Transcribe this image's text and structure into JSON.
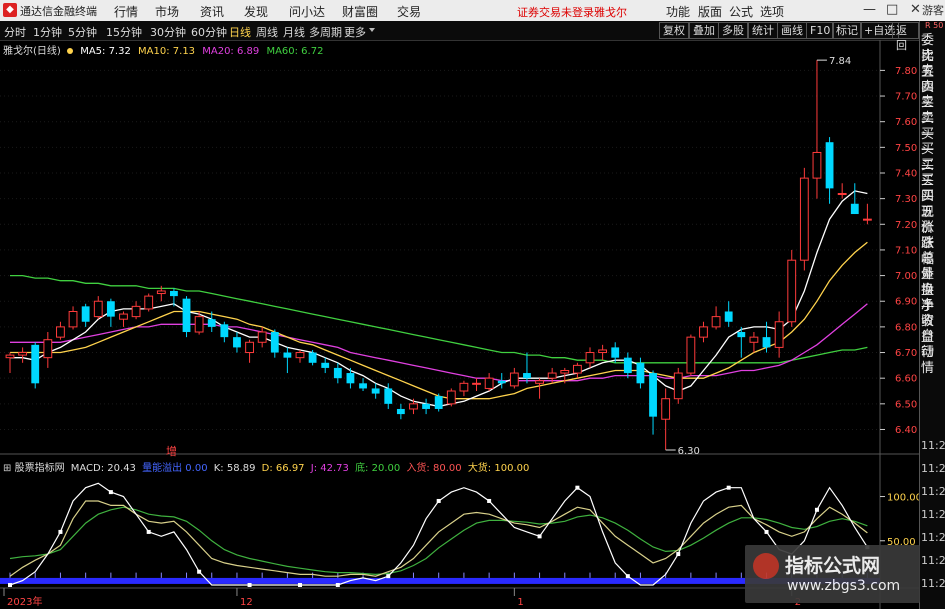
{
  "app": {
    "title": "通达信金融终端",
    "status_warning": "证券交易未登录",
    "stock_short": "雅戈尔"
  },
  "top_menu": [
    "行情",
    "市场",
    "资讯",
    "发现",
    "问小达",
    "财富圈",
    "交易"
  ],
  "right_menu": [
    "功能",
    "版面",
    "公式",
    "选项"
  ],
  "window_buttons": [
    "—",
    "□",
    "✕"
  ],
  "periods": [
    "分时",
    "1分钟",
    "5分钟",
    "15分钟",
    "30分钟",
    "60分钟",
    "日线",
    "周线",
    "月线",
    "多周期",
    "更多"
  ],
  "active_period": "日线",
  "tools": [
    "复权",
    "叠加",
    "多股",
    "统计",
    "画线",
    "F10",
    "标记",
    "+自选",
    "返回"
  ],
  "main_legend": {
    "name": "雅戈尔(日线)",
    "ma5": "MA5: 7.32",
    "ma10": "MA10: 7.13",
    "ma20": "MA20: 6.89",
    "ma60": "MA60: 6.72",
    "colors": {
      "ma5": "#ffffff",
      "ma10": "#ffd34d",
      "ma20": "#e040e0",
      "ma60": "#40d040",
      "up": "#ff3b3b",
      "down": "#00d8ff"
    }
  },
  "sub_legend": {
    "name": "股票指标网",
    "macd": "MACD: 20.43",
    "status": "量能溢出",
    "status_val": "0.00",
    "k": "K: 58.89",
    "d": "D: 66.97",
    "j": "J: 42.73",
    "di": "底: 20.00",
    "ru": "入货: 80.00",
    "da": "大货: 100.00"
  },
  "marker_label": "增",
  "right_panel": {
    "items": [
      "委比",
      "卖五",
      "卖四",
      "卖三",
      "卖二",
      "卖一",
      "买一",
      "买二",
      "买三",
      "买四",
      "买五",
      "现价",
      "涨跌",
      "涨幅",
      "总量",
      "外盘",
      "换手",
      "净资",
      "收益",
      "自动",
      "行情"
    ],
    "time_prefix": "11:25",
    "time_count": 7,
    "top_label": "R 50"
  },
  "login_label": "游客",
  "x_labels": [
    "2023年",
    "12",
    "1",
    "2"
  ],
  "watermark": {
    "title": "指标公式网",
    "url": "www.zbgs3.com"
  },
  "chart_data": {
    "type": "candlestick",
    "yaxis_ticks": [
      7.8,
      7.7,
      7.6,
      7.5,
      7.4,
      7.3,
      7.2,
      7.1,
      7.0,
      6.9,
      6.8,
      6.7,
      6.6,
      6.5,
      6.4
    ],
    "ylim": [
      6.32,
      7.86
    ],
    "annotations": [
      {
        "text": "7.84",
        "type": "high"
      },
      {
        "text": "6.30",
        "type": "low"
      }
    ],
    "candles": [
      [
        6.68,
        6.7,
        6.62,
        6.69
      ],
      [
        6.69,
        6.72,
        6.66,
        6.7
      ],
      [
        6.73,
        6.74,
        6.56,
        6.58
      ],
      [
        6.68,
        6.78,
        6.64,
        6.75
      ],
      [
        6.76,
        6.82,
        6.75,
        6.8
      ],
      [
        6.8,
        6.88,
        6.79,
        6.86
      ],
      [
        6.88,
        6.89,
        6.8,
        6.82
      ],
      [
        6.84,
        6.92,
        6.83,
        6.9
      ],
      [
        6.9,
        6.91,
        6.8,
        6.84
      ],
      [
        6.83,
        6.86,
        6.8,
        6.85
      ],
      [
        6.84,
        6.9,
        6.83,
        6.88
      ],
      [
        6.87,
        6.93,
        6.86,
        6.92
      ],
      [
        6.93,
        6.96,
        6.9,
        6.94
      ],
      [
        6.94,
        6.95,
        6.88,
        6.92
      ],
      [
        6.91,
        6.92,
        6.76,
        6.78
      ],
      [
        6.78,
        6.86,
        6.77,
        6.84
      ],
      [
        6.83,
        6.86,
        6.78,
        6.8
      ],
      [
        6.81,
        6.82,
        6.74,
        6.76
      ],
      [
        6.76,
        6.78,
        6.7,
        6.72
      ],
      [
        6.7,
        6.75,
        6.66,
        6.74
      ],
      [
        6.74,
        6.8,
        6.72,
        6.78
      ],
      [
        6.78,
        6.79,
        6.68,
        6.7
      ],
      [
        6.7,
        6.72,
        6.62,
        6.68
      ],
      [
        6.68,
        6.71,
        6.66,
        6.7
      ],
      [
        6.7,
        6.71,
        6.65,
        6.66
      ],
      [
        6.66,
        6.68,
        6.62,
        6.64
      ],
      [
        6.64,
        6.66,
        6.58,
        6.6
      ],
      [
        6.62,
        6.64,
        6.56,
        6.58
      ],
      [
        6.58,
        6.6,
        6.55,
        6.56
      ],
      [
        6.56,
        6.58,
        6.52,
        6.54
      ],
      [
        6.56,
        6.58,
        6.48,
        6.5
      ],
      [
        6.48,
        6.5,
        6.44,
        6.46
      ],
      [
        6.48,
        6.52,
        6.46,
        6.5
      ],
      [
        6.5,
        6.52,
        6.46,
        6.48
      ],
      [
        6.53,
        6.54,
        6.47,
        6.48
      ],
      [
        6.5,
        6.56,
        6.49,
        6.55
      ],
      [
        6.55,
        6.59,
        6.53,
        6.58
      ],
      [
        6.58,
        6.6,
        6.55,
        6.58
      ],
      [
        6.56,
        6.62,
        6.55,
        6.6
      ],
      [
        6.59,
        6.62,
        6.56,
        6.58
      ],
      [
        6.57,
        6.64,
        6.56,
        6.62
      ],
      [
        6.62,
        6.7,
        6.58,
        6.6
      ],
      [
        6.58,
        6.6,
        6.52,
        6.59
      ],
      [
        6.6,
        6.64,
        6.58,
        6.62
      ],
      [
        6.62,
        6.64,
        6.58,
        6.63
      ],
      [
        6.62,
        6.66,
        6.6,
        6.65
      ],
      [
        6.66,
        6.72,
        6.64,
        6.7
      ],
      [
        6.7,
        6.73,
        6.67,
        6.71
      ],
      [
        6.72,
        6.74,
        6.66,
        6.68
      ],
      [
        6.68,
        6.7,
        6.6,
        6.62
      ],
      [
        6.66,
        6.68,
        6.56,
        6.58
      ],
      [
        6.62,
        6.63,
        6.38,
        6.45
      ],
      [
        6.44,
        6.56,
        6.32,
        6.52
      ],
      [
        6.52,
        6.64,
        6.5,
        6.62
      ],
      [
        6.62,
        6.77,
        6.61,
        6.76
      ],
      [
        6.76,
        6.82,
        6.74,
        6.8
      ],
      [
        6.8,
        6.88,
        6.79,
        6.84
      ],
      [
        6.86,
        6.9,
        6.8,
        6.82
      ],
      [
        6.78,
        6.8,
        6.68,
        6.76
      ],
      [
        6.74,
        6.78,
        6.7,
        6.76
      ],
      [
        6.76,
        6.82,
        6.7,
        6.72
      ],
      [
        6.72,
        6.86,
        6.68,
        6.82
      ],
      [
        6.82,
        7.1,
        6.8,
        7.06
      ],
      [
        7.06,
        7.42,
        7.02,
        7.38
      ],
      [
        7.38,
        7.84,
        7.3,
        7.48
      ],
      [
        7.52,
        7.54,
        7.28,
        7.34
      ],
      [
        7.32,
        7.36,
        7.3,
        7.32
      ],
      [
        7.28,
        7.36,
        7.24,
        7.24
      ],
      [
        7.22,
        7.28,
        7.2,
        7.22
      ]
    ],
    "ma5": [
      6.68,
      6.68,
      6.67,
      6.7,
      6.72,
      6.75,
      6.78,
      6.83,
      6.86,
      6.87,
      6.87,
      6.87,
      6.88,
      6.89,
      6.86,
      6.85,
      6.83,
      6.8,
      6.78,
      6.76,
      6.76,
      6.74,
      6.72,
      6.71,
      6.7,
      6.68,
      6.66,
      6.63,
      6.61,
      6.58,
      6.56,
      6.53,
      6.51,
      6.5,
      6.49,
      6.5,
      6.51,
      6.53,
      6.55,
      6.58,
      6.6,
      6.6,
      6.6,
      6.6,
      6.61,
      6.62,
      6.64,
      6.66,
      6.67,
      6.67,
      6.65,
      6.61,
      6.57,
      6.55,
      6.57,
      6.63,
      6.69,
      6.76,
      6.79,
      6.8,
      6.8,
      6.79,
      6.83,
      6.94,
      7.09,
      7.22,
      7.29,
      7.33,
      7.32
    ],
    "ma10": [
      6.7,
      6.7,
      6.7,
      6.7,
      6.7,
      6.71,
      6.72,
      6.74,
      6.76,
      6.78,
      6.8,
      6.82,
      6.84,
      6.86,
      6.86,
      6.86,
      6.85,
      6.84,
      6.83,
      6.81,
      6.8,
      6.78,
      6.76,
      6.74,
      6.73,
      6.71,
      6.69,
      6.67,
      6.65,
      6.63,
      6.61,
      6.59,
      6.57,
      6.55,
      6.53,
      6.52,
      6.52,
      6.52,
      6.52,
      6.53,
      6.54,
      6.56,
      6.57,
      6.58,
      6.59,
      6.6,
      6.61,
      6.62,
      6.63,
      6.63,
      6.63,
      6.62,
      6.61,
      6.6,
      6.6,
      6.6,
      6.62,
      6.64,
      6.67,
      6.7,
      6.72,
      6.74,
      6.78,
      6.83,
      6.9,
      6.98,
      7.04,
      7.09,
      7.13
    ],
    "ma20": [
      6.74,
      6.74,
      6.74,
      6.74,
      6.74,
      6.75,
      6.76,
      6.77,
      6.78,
      6.79,
      6.8,
      6.8,
      6.81,
      6.81,
      6.81,
      6.81,
      6.81,
      6.8,
      6.8,
      6.79,
      6.78,
      6.77,
      6.76,
      6.75,
      6.74,
      6.73,
      6.72,
      6.7,
      6.69,
      6.68,
      6.67,
      6.66,
      6.65,
      6.64,
      6.63,
      6.62,
      6.61,
      6.6,
      6.6,
      6.59,
      6.59,
      6.59,
      6.59,
      6.59,
      6.59,
      6.59,
      6.6,
      6.6,
      6.61,
      6.61,
      6.61,
      6.61,
      6.6,
      6.6,
      6.61,
      6.61,
      6.61,
      6.62,
      6.63,
      6.63,
      6.64,
      6.65,
      6.67,
      6.7,
      6.73,
      6.77,
      6.81,
      6.85,
      6.89
    ],
    "ma60": [
      7.0,
      7.0,
      6.99,
      6.99,
      6.98,
      6.98,
      6.97,
      6.97,
      6.96,
      6.96,
      6.96,
      6.95,
      6.95,
      6.95,
      6.94,
      6.94,
      6.93,
      6.92,
      6.91,
      6.9,
      6.89,
      6.88,
      6.87,
      6.86,
      6.85,
      6.84,
      6.83,
      6.82,
      6.81,
      6.8,
      6.79,
      6.78,
      6.77,
      6.76,
      6.75,
      6.74,
      6.73,
      6.72,
      6.71,
      6.7,
      6.7,
      6.69,
      6.69,
      6.68,
      6.68,
      6.67,
      6.67,
      6.67,
      6.66,
      6.66,
      6.66,
      6.66,
      6.66,
      6.66,
      6.66,
      6.66,
      6.66,
      6.66,
      6.66,
      6.66,
      6.66,
      6.66,
      6.67,
      6.68,
      6.69,
      6.7,
      6.71,
      6.71,
      6.72
    ],
    "sub": {
      "ylim": [
        0,
        130
      ],
      "ticks": [
        100.0,
        50.0
      ],
      "k": [
        10,
        20,
        28,
        35,
        45,
        75,
        95,
        95,
        90,
        90,
        80,
        72,
        70,
        72,
        60,
        45,
        30,
        25,
        22,
        20,
        18,
        16,
        14,
        12,
        12,
        10,
        10,
        12,
        12,
        10,
        15,
        20,
        30,
        45,
        60,
        70,
        80,
        82,
        80,
        75,
        70,
        68,
        65,
        72,
        80,
        88,
        85,
        70,
        55,
        45,
        35,
        25,
        30,
        40,
        55,
        70,
        80,
        88,
        90,
        75,
        68,
        60,
        55,
        60,
        75,
        88,
        80,
        70,
        58.89
      ],
      "d": [
        30,
        32,
        33,
        35,
        40,
        55,
        70,
        80,
        85,
        88,
        85,
        80,
        78,
        77,
        72,
        62,
        50,
        40,
        34,
        30,
        27,
        24,
        21,
        19,
        17,
        15,
        14,
        14,
        13,
        12,
        13,
        16,
        22,
        30,
        42,
        52,
        62,
        70,
        73,
        73,
        72,
        71,
        69,
        70,
        72,
        77,
        79,
        76,
        70,
        62,
        52,
        43,
        38,
        39,
        45,
        53,
        62,
        70,
        76,
        76,
        74,
        70,
        65,
        63,
        66,
        72,
        75,
        72,
        66.97
      ],
      "j": [
        0,
        5,
        15,
        35,
        60,
        95,
        110,
        115,
        105,
        100,
        80,
        60,
        55,
        60,
        40,
        15,
        0,
        0,
        0,
        0,
        0,
        0,
        0,
        0,
        0,
        0,
        0,
        5,
        8,
        5,
        10,
        25,
        45,
        75,
        95,
        105,
        110,
        105,
        95,
        80,
        65,
        60,
        55,
        75,
        95,
        110,
        100,
        60,
        25,
        10,
        0,
        0,
        12,
        35,
        70,
        95,
        105,
        110,
        110,
        75,
        60,
        40,
        35,
        50,
        85,
        110,
        90,
        65,
        42.73
      ],
      "white_dots": [
        20,
        29,
        24,
        47,
        31,
        52,
        54,
        43,
        13,
        18,
        9,
        20,
        15,
        63,
        40,
        50,
        64,
        10,
        12
      ]
    }
  }
}
